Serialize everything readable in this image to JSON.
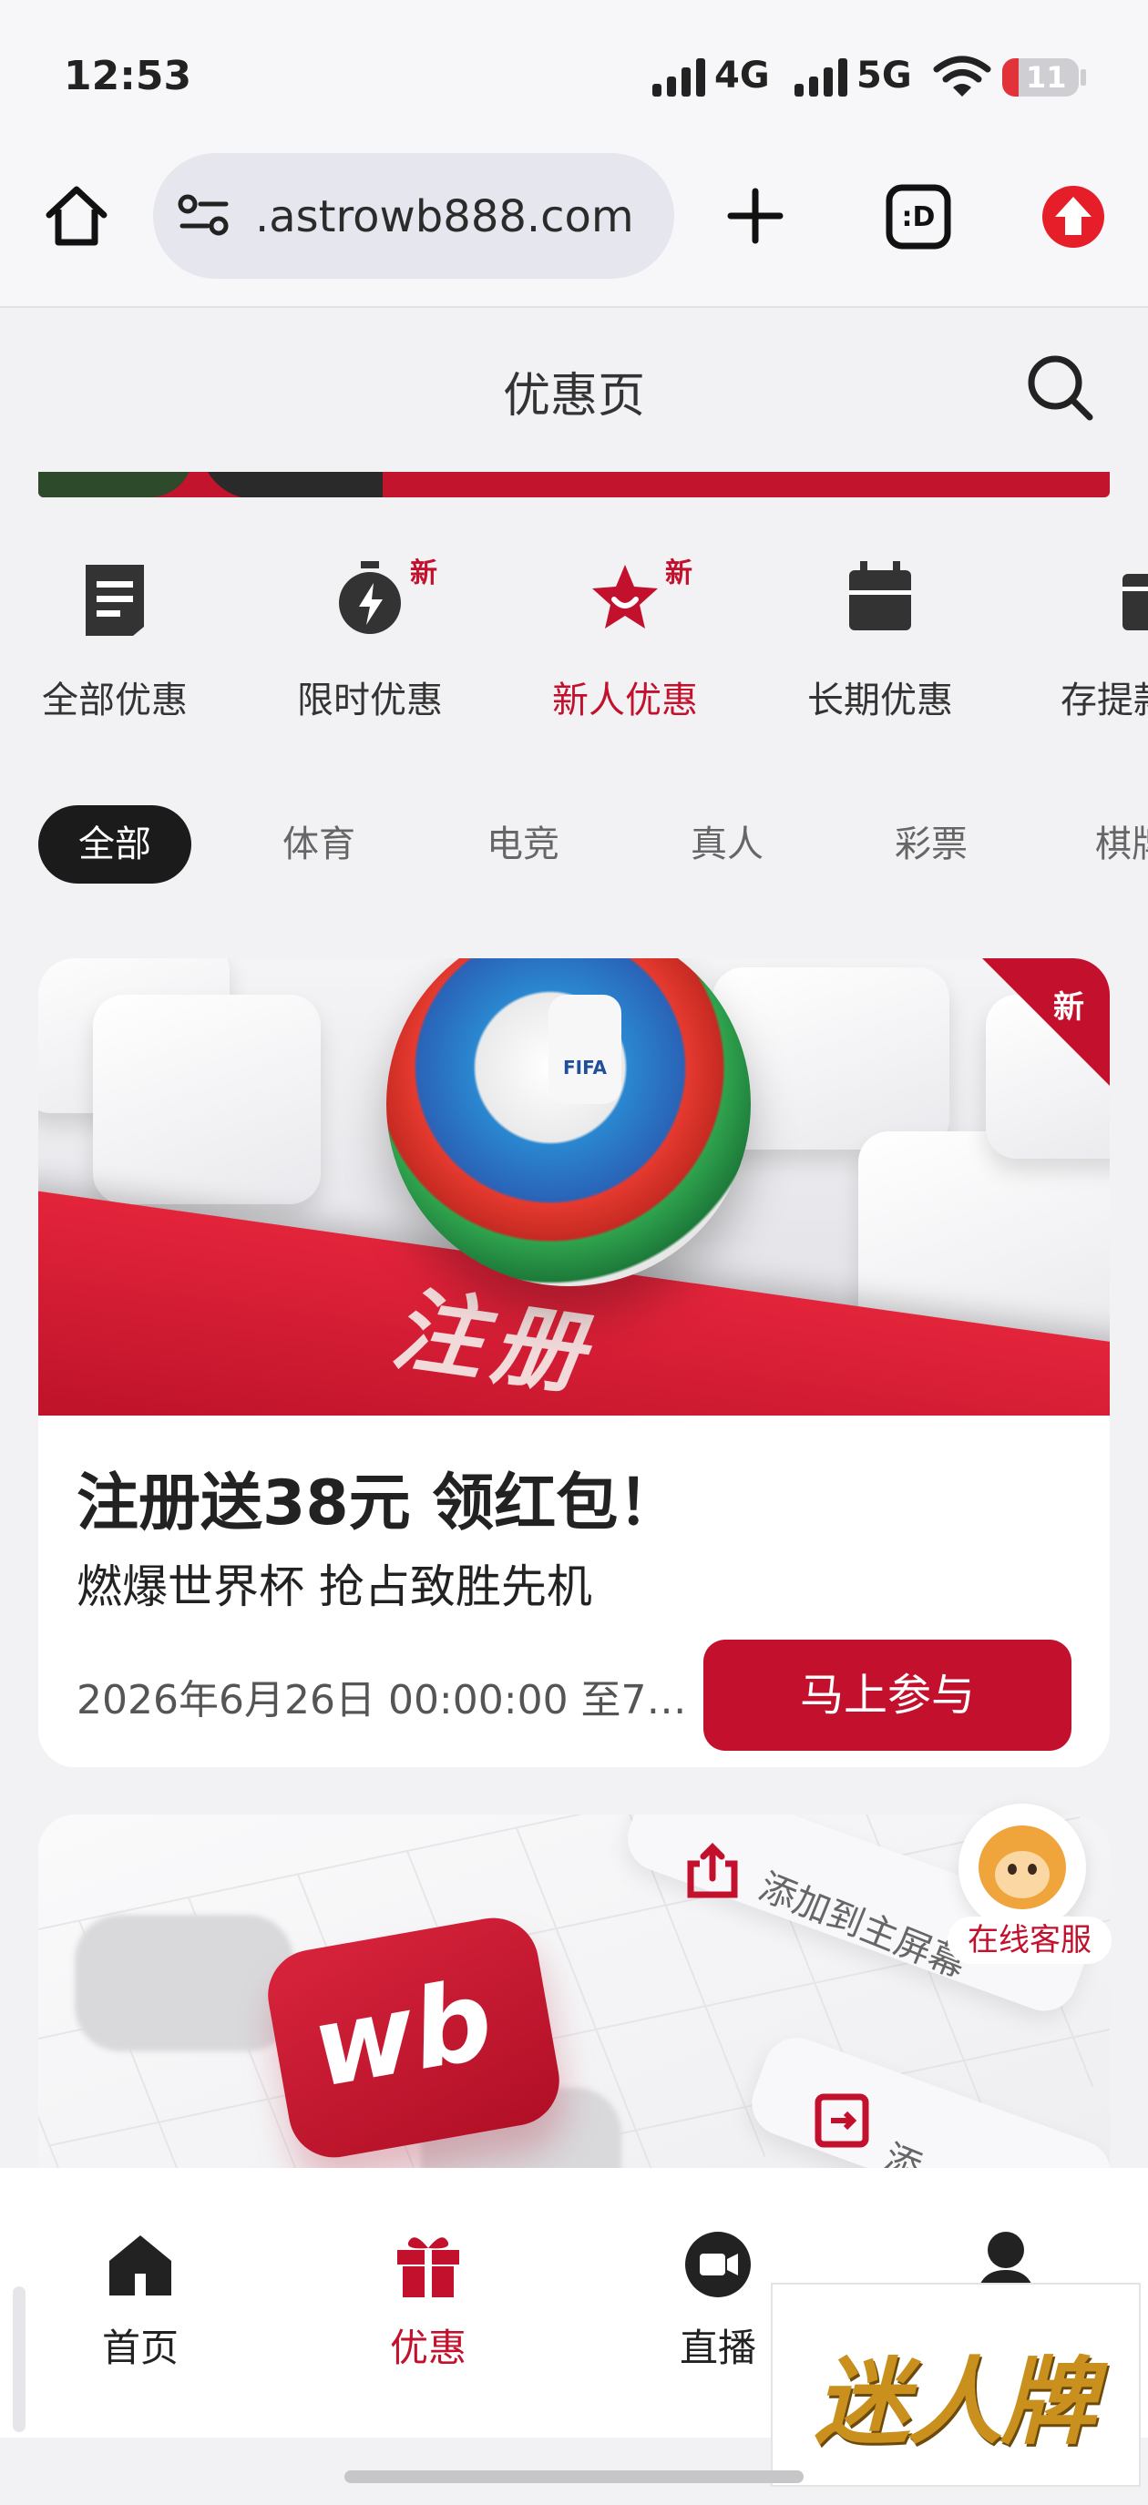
{
  "status_bar": {
    "time": "12:53",
    "network_1": "4G",
    "network_2": "5G",
    "battery": "11",
    "battery_color": "#e2333a"
  },
  "browser": {
    "url": ".astrowb888.com",
    "icons": [
      "home-icon",
      "site-settings-icon",
      "new-tab-icon",
      "tab-switcher-icon",
      "update-icon"
    ]
  },
  "header": {
    "title": "优惠页"
  },
  "categories": [
    {
      "label": "全部优惠",
      "icon": "document-icon",
      "badge": ""
    },
    {
      "label": "限时优惠",
      "icon": "stopwatch-icon",
      "badge": "新"
    },
    {
      "label": "新人优惠",
      "icon": "star-badge-icon",
      "badge": "新",
      "active": true
    },
    {
      "label": "长期优惠",
      "icon": "calendar-icon",
      "badge": ""
    },
    {
      "label": "存提款",
      "icon": "wallet-icon",
      "badge": ""
    }
  ],
  "filters": [
    "全部",
    "体育",
    "电竞",
    "真人",
    "彩票",
    "棋牌"
  ],
  "promo_card": {
    "image_text": "注册",
    "ball_emblem": "FIFA",
    "corner_badge": "新",
    "title": "注册送38元 领红包！",
    "subtitle": "燃爆世界杯 抢占致胜先机",
    "date": "2026年6月26日 00:00:00 至7…",
    "cta": "马上参与"
  },
  "promo_card_2": {
    "chip_1": "添加到主屏幕",
    "chip_2": "添",
    "app_logo": "wb"
  },
  "service": {
    "label": "在线客服"
  },
  "bottom_nav": [
    {
      "label": "首页",
      "icon": "home-icon"
    },
    {
      "label": "优惠",
      "icon": "gift-icon",
      "active": true
    },
    {
      "label": "直播",
      "icon": "live-camera-icon"
    },
    {
      "label": "",
      "icon": "profile-icon"
    }
  ],
  "watermark": "迷人牌",
  "colors": {
    "brand_red": "#c3102d",
    "dark": "#1b1b1b",
    "background": "#f2f2f4"
  }
}
